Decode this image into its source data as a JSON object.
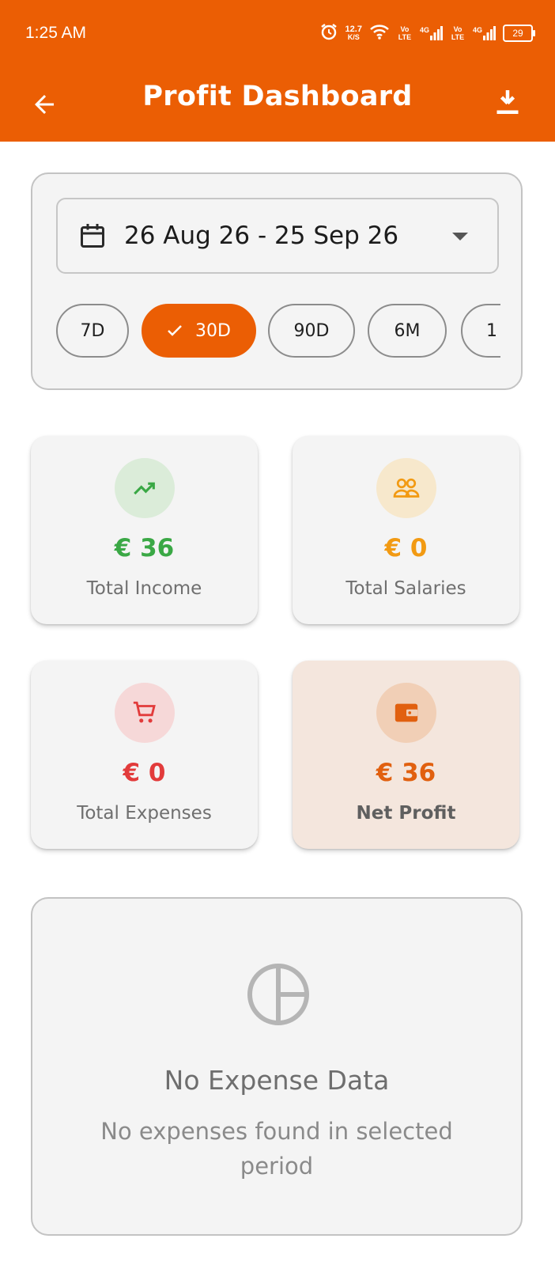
{
  "status_bar": {
    "time": "1:25 AM",
    "net_speed_value": "12.7",
    "net_speed_unit": "K/S",
    "sim1": "Vo LTE",
    "sim1_network": "4G",
    "sim2": "Vo LTE",
    "sim2_network": "4G",
    "battery": "29",
    "icons": [
      "alarm-icon",
      "wifi-icon",
      "signal-icon",
      "signal-icon",
      "battery-icon"
    ]
  },
  "app_bar": {
    "title": "Profit Dashboard",
    "back_icon": "arrow-back-icon",
    "download_icon": "download-icon"
  },
  "filter": {
    "date_range": "26 Aug 26 - 25 Sep 26",
    "calendar_icon": "calendar-icon",
    "dropdown_icon": "chevron-down-icon",
    "chips": [
      {
        "label": "7D",
        "selected": false
      },
      {
        "label": "30D",
        "selected": true
      },
      {
        "label": "90D",
        "selected": false
      },
      {
        "label": "6M",
        "selected": false
      },
      {
        "label": "1",
        "selected": false
      }
    ]
  },
  "stats": {
    "income": {
      "value": "€ 36",
      "label": "Total Income",
      "icon": "trending-up-icon",
      "color": "#3aa845"
    },
    "salaries": {
      "value": "€ 0",
      "label": "Total Salaries",
      "icon": "people-icon",
      "color": "#f29a12"
    },
    "expenses": {
      "value": "€ 0",
      "label": "Total Expenses",
      "icon": "cart-icon",
      "color": "#e23b3b"
    },
    "net_profit": {
      "value": "€ 36",
      "label": "Net Profit",
      "icon": "wallet-icon",
      "color": "#e1600f"
    }
  },
  "empty_state": {
    "icon": "pie-chart-icon",
    "title": "No Expense Data",
    "subtitle": "No expenses found in selected period"
  },
  "colors": {
    "primary": "#eb5e04",
    "card_bg": "#f4f4f4",
    "border": "#c3c3c3"
  }
}
